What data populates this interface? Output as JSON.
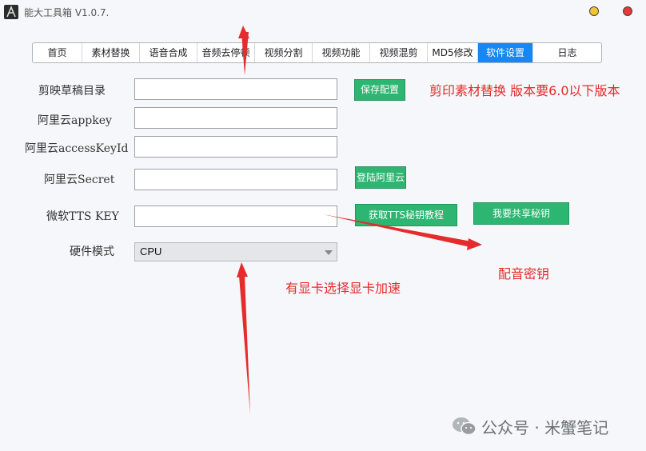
{
  "window": {
    "title": "能大工具箱 V1.0.7."
  },
  "tabs": [
    {
      "label": "首页"
    },
    {
      "label": "素材替换"
    },
    {
      "label": "语音合成"
    },
    {
      "label": "音频去停顿"
    },
    {
      "label": "视频分割"
    },
    {
      "label": "视频功能"
    },
    {
      "label": "视频混剪"
    },
    {
      "label": "MD5修改"
    },
    {
      "label": "软件设置",
      "active": true
    },
    {
      "label": "日志"
    }
  ],
  "form": {
    "draft_dir_label": "剪映草稿目录",
    "draft_dir_value": "",
    "aliyun_appkey_label": "阿里云appkey",
    "aliyun_appkey_value": "",
    "aliyun_access_label": "阿里云accessKeyId",
    "aliyun_access_value": "",
    "aliyun_secret_label": "阿里云Secret",
    "aliyun_secret_value": "",
    "ms_tts_label": "微软TTS KEY",
    "ms_tts_value": "",
    "hw_mode_label": "硬件模式",
    "hw_mode_value": "CPU"
  },
  "buttons": {
    "save_config": "保存配置",
    "login_aliyun": "登陆阿里云",
    "tts_tutorial": "获取TTS秘钥教程",
    "share_key": "我要共享秘钥"
  },
  "annotations": {
    "version_note": "剪印素材替换 版本要6.0以下版本",
    "dubbing_key": "配音密钥",
    "gpu_note": "有显卡选择显卡加速"
  },
  "watermark": {
    "text": "公众号 · 米蟹笔记"
  },
  "colors": {
    "accent_blue": "#1787f5",
    "button_green": "#2cb671",
    "annotation_red": "#e52b2b"
  }
}
